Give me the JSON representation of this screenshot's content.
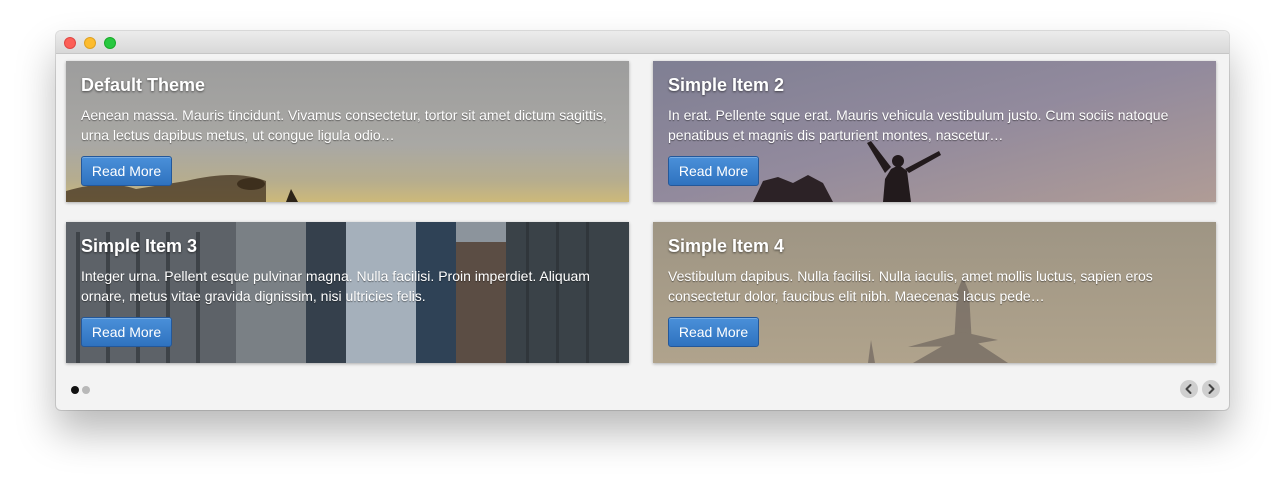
{
  "carousel": {
    "items": [
      {
        "title": "Default Theme",
        "text": "Aenean massa. Mauris tincidunt. Vivamus consectetur, tortor sit amet dictum sagittis, urna lectus dapibus metus, ut congue ligula odio…",
        "button": "Read More"
      },
      {
        "title": "Simple Item 2",
        "text": "In erat. Pellente sque erat. Mauris vehicula vestibulum justo. Cum sociis natoque penatibus et magnis dis parturient montes, nascetur…",
        "button": "Read More"
      },
      {
        "title": "Simple Item 3",
        "text": "Integer urna. Pellent esque pulvinar magna. Nulla facilisi. Proin imperdiet. Aliquam ornare, metus vitae gravida dignissim, nisi ultricies felis.",
        "button": "Read More"
      },
      {
        "title": "Simple Item 4",
        "text": "Vestibulum dapibus. Nulla facilisi. Nulla iaculis, amet mollis luctus, sapien eros consectetur dolor, faucibus elit nibh. Maecenas lacus pede…",
        "button": "Read More"
      }
    ],
    "pagination": {
      "pages": 2,
      "active_page": 1
    },
    "nav": {
      "prev_icon": "chevron-left-icon",
      "next_icon": "chevron-right-icon"
    }
  },
  "colors": {
    "button": "#3b82cc",
    "active_dot": "#111111",
    "inactive_dot": "#b8b8b8"
  }
}
